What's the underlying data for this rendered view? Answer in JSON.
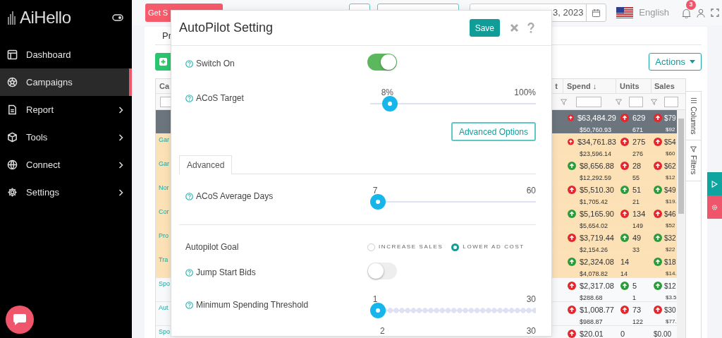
{
  "sidebar": {
    "logo": "AiHello",
    "items": [
      {
        "label": "Dashboard",
        "selected": false,
        "submenu": false
      },
      {
        "label": "Campaigns",
        "selected": true,
        "submenu": false
      },
      {
        "label": "Report",
        "selected": false,
        "submenu": true
      },
      {
        "label": "Tools",
        "selected": false,
        "submenu": true
      },
      {
        "label": "Connect",
        "selected": false,
        "submenu": true
      },
      {
        "label": "Settings",
        "selected": false,
        "submenu": true
      }
    ]
  },
  "topbar": {
    "promo_button": "Get S",
    "date_range": "3, 2023",
    "language": "English",
    "notification_count": "3"
  },
  "page": {
    "tab": "Pr",
    "actions_button": "Actions",
    "table": {
      "columns": [
        "Ca",
        "t",
        "Spend ↓",
        "Units",
        "Sales"
      ],
      "side_tabs": [
        "Columns",
        "Filters"
      ],
      "rows": [
        {
          "kind": "total",
          "name": "",
          "spend": {
            "value": "$63,484.29",
            "previous": "$50,760.93",
            "color": "#e5262d"
          },
          "units": {
            "value": "629",
            "previous": "671",
            "color": "#e5262d"
          },
          "sales": {
            "value": "$79",
            "previous": "$92",
            "color": "#e5262d"
          }
        },
        {
          "kind": "flagged",
          "name": "Gar",
          "spend": {
            "value": "$34,761.83",
            "previous": "$23,596.14",
            "color": "#e5262d"
          },
          "units": {
            "value": "275",
            "previous": "276",
            "color": "#e5262d"
          },
          "sales": {
            "value": "$54",
            "previous": "$60",
            "color": "#e5262d"
          }
        },
        {
          "kind": "flagged",
          "name": "Gar",
          "spend": {
            "value": "$8,656.88",
            "previous": "$12,292.59",
            "color": "#2a9d3a"
          },
          "units": {
            "value": "28",
            "previous": "55",
            "color": "#e5262d"
          },
          "sales": {
            "value": "$62",
            "previous": "$12",
            "color": "#e5262d"
          }
        },
        {
          "kind": "flagged",
          "name": "Nor",
          "spend": {
            "value": "$5,510.30",
            "previous": "$1,705.42",
            "color": "#e5262d"
          },
          "units": {
            "value": "51",
            "previous": "21",
            "color": "#2a9d3a"
          },
          "sales": {
            "value": "$49",
            "previous": "$19.",
            "color": "#2a9d3a"
          }
        },
        {
          "kind": "flagged",
          "name": "Cor",
          "spend": {
            "value": "$5,165.90",
            "previous": "$5,654.02",
            "color": "#2a9d3a"
          },
          "units": {
            "value": "134",
            "previous": "149",
            "color": "#e5262d"
          },
          "sales": {
            "value": "$46",
            "previous": "$52",
            "color": "#e5262d"
          }
        },
        {
          "kind": "flagged",
          "name": "Pro",
          "spend": {
            "value": "$3,719.44",
            "previous": "$2,154.26",
            "color": "#e5262d"
          },
          "units": {
            "value": "49",
            "previous": "33",
            "color": "#2a9d3a"
          },
          "sales": {
            "value": "$32",
            "previous": "$22",
            "color": "#2a9d3a"
          }
        },
        {
          "kind": "flagged",
          "name": "Tra",
          "spend": {
            "value": "$2,324.08",
            "previous": "$4,078.82",
            "color": "#2a9d3a"
          },
          "units": {
            "value": "14",
            "previous": "14"
          },
          "sales": {
            "value": "$18",
            "previous": "$14.",
            "color": "#2a9d3a"
          }
        },
        {
          "kind": "normal",
          "name": "Spo",
          "spend": {
            "value": "$2,317.08",
            "previous": "$288.68",
            "color": "#e5262d"
          },
          "units": {
            "value": "5",
            "previous": "1",
            "color": "#2a9d3a"
          },
          "sales": {
            "value": "$12",
            "previous": "$3.5",
            "color": "#2a9d3a"
          }
        },
        {
          "kind": "normal",
          "name": "Aut",
          "spend": {
            "value": "$1,008.77",
            "previous": "$988.87",
            "color": "#e5262d"
          },
          "units": {
            "value": "73",
            "previous": "122",
            "color": "#e5262d"
          },
          "sales": {
            "value": "$30",
            "previous": "$77.",
            "color": "#e5262d"
          }
        },
        {
          "kind": "normal",
          "name": "Spo",
          "spend": {
            "value": "$20.01",
            "color": "#e5262d"
          },
          "units": {
            "value": "0"
          },
          "sales": {
            "value": "$0.00"
          }
        }
      ]
    }
  },
  "modal": {
    "title": "AutoPilot Setting",
    "save_button": "Save",
    "general_rows": [
      {
        "kind": "toggle",
        "label": "Switch On",
        "help": true,
        "on": true
      },
      {
        "kind": "slider",
        "label": "ACoS Target",
        "help": true,
        "value_label": "8%",
        "max_label": "100%",
        "level": 0.08
      }
    ],
    "advanced_button": "Advanced Options",
    "tabs": [
      {
        "label": "Advanced",
        "selected": true
      }
    ],
    "advanced_rows": [
      {
        "kind": "slider",
        "label": "ACoS Average Days",
        "help": true,
        "value_label": "7",
        "max_label": "60",
        "level": 0
      }
    ],
    "goal_rows": [
      {
        "kind": "radio",
        "label": "Autopilot Goal",
        "help": false,
        "options": [
          {
            "label": "INCREASE SALES",
            "selected": false
          },
          {
            "label": "LOWER AD COST",
            "selected": true
          }
        ]
      },
      {
        "kind": "toggle",
        "label": "Jump Start Bids",
        "help": true,
        "on": false
      },
      {
        "kind": "step-slider",
        "label": "Minimum Spending Threshold",
        "help": true,
        "value_label": "1",
        "max_label": "30",
        "level": 0
      },
      {
        "kind": "slider-labels",
        "value_label": "2",
        "max_label": "30"
      }
    ]
  }
}
